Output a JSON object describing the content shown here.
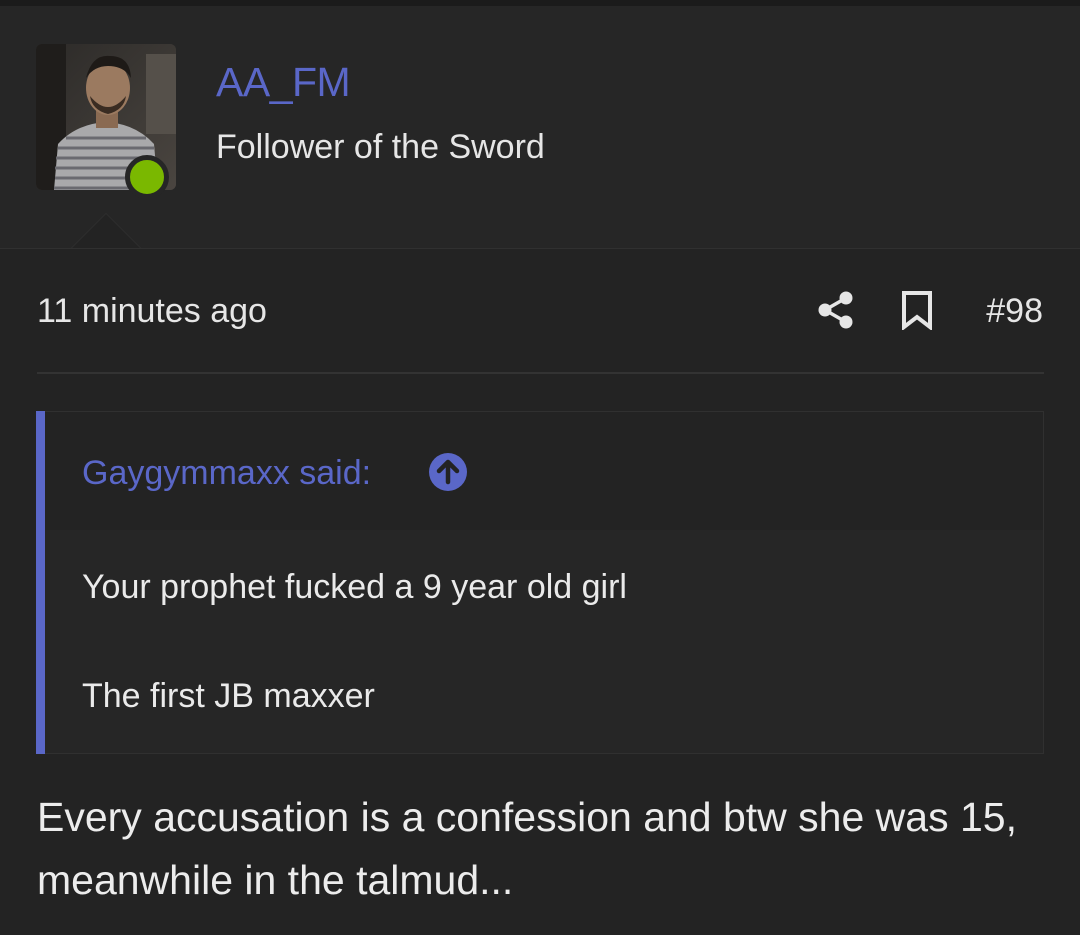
{
  "user": {
    "username": "AA_FM",
    "title": "Follower of the Sword",
    "online": true,
    "avatar_icon": "user-photo",
    "online_color": "#7ab800"
  },
  "post": {
    "time": "11 minutes ago",
    "number": "#98",
    "actions": {
      "share_icon": "share-icon",
      "bookmark_icon": "bookmark-icon"
    },
    "quote": {
      "author_line": "Gaygymmaxx said:",
      "jump_icon": "arrow-up-circle-icon",
      "lines": [
        "Your prophet fucked a 9 year old girl",
        "The first JB maxxer"
      ]
    },
    "body": "Every accusation is a confession and btw she was 15, meanwhile in the talmud..."
  },
  "colors": {
    "accent": "#5a67c8",
    "background": "#232323",
    "text": "#ebebeb"
  }
}
